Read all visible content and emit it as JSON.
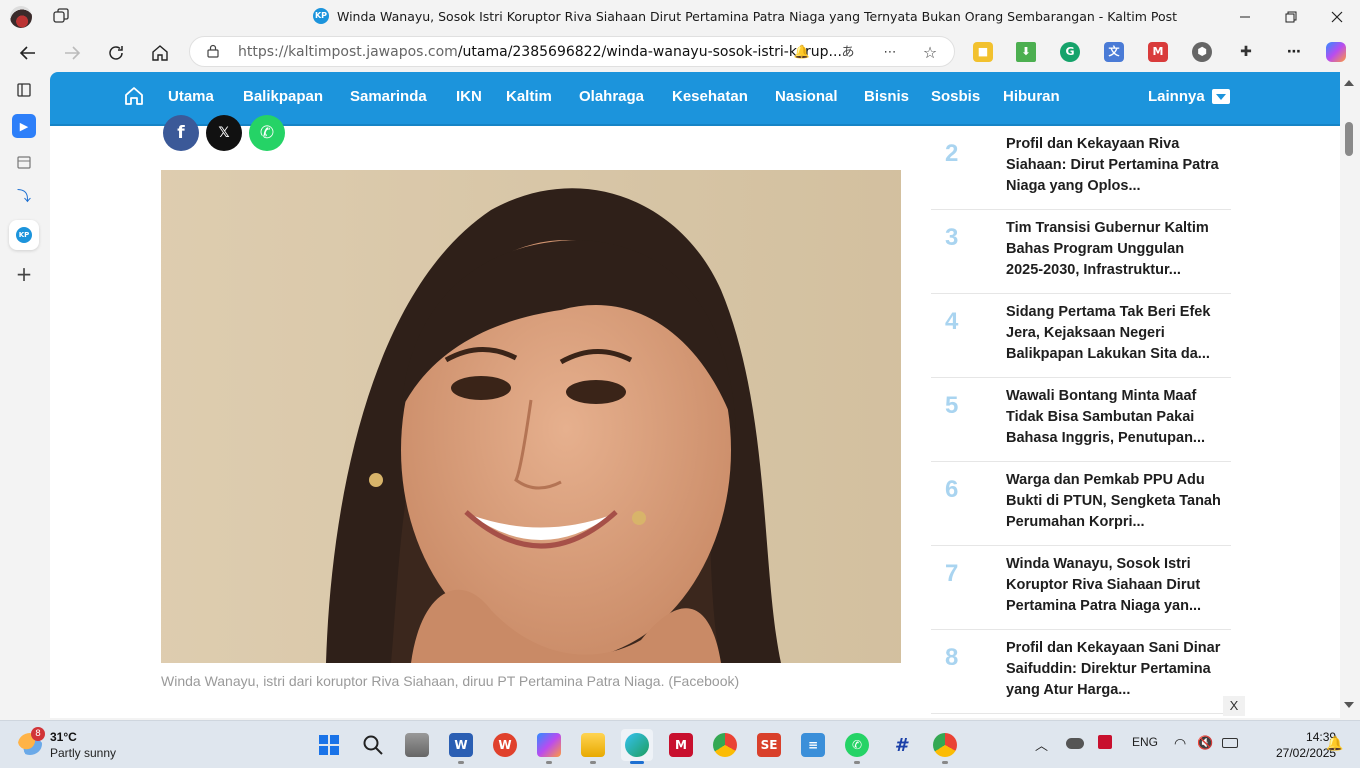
{
  "browser": {
    "tab_title": "Winda Wanayu, Sosok Istri Koruptor Riva Siahaan Dirut Pertamina Patra Niaga yang Ternyata Bukan Orang Sembarangan - Kaltim Post",
    "url_domain": "https://kaltimpost.jawapos.com",
    "url_path": "/utama/2385696822/winda-wanayu-sosok-istri-korup...",
    "site_badge": "KP"
  },
  "nav": {
    "items": [
      "Utama",
      "Balikpapan",
      "Samarinda",
      "IKN",
      "Kaltim",
      "Olahraga",
      "Kesehatan",
      "Nasional",
      "Bisnis",
      "Sosbis",
      "Hiburan"
    ],
    "more_label": "Lainnya"
  },
  "share": {
    "facebook": "f",
    "x": "𝕏",
    "whatsapp": "✆"
  },
  "article": {
    "caption": "Winda Wanayu, istri dari koruptor Riva Siahaan, diruu PT Pertamina Patra Niaga. (Facebook)"
  },
  "popular": [
    {
      "num": "2",
      "title": "Profil dan Kekayaan Riva Siahaan: Dirut Pertamina Patra Niaga yang Oplos..."
    },
    {
      "num": "3",
      "title": "Tim Transisi Gubernur Kaltim Bahas Program Unggulan 2025-2030, Infrastruktur..."
    },
    {
      "num": "4",
      "title": "Sidang Pertama Tak Beri Efek Jera, Kejaksaan Negeri Balikpapan Lakukan Sita da..."
    },
    {
      "num": "5",
      "title": "Wawali Bontang Minta Maaf Tidak Bisa Sambutan Pakai Bahasa Inggris, Penutupan..."
    },
    {
      "num": "6",
      "title": "Warga dan Pemkab PPU Adu Bukti di PTUN, Sengketa Tanah Perumahan Korpri..."
    },
    {
      "num": "7",
      "title": "Winda Wanayu, Sosok Istri Koruptor Riva Siahaan Dirut Pertamina Patra Niaga yan..."
    },
    {
      "num": "8",
      "title": "Profil dan Kekayaan Sani Dinar Saifuddin: Direktur Pertamina yang Atur Harga..."
    }
  ],
  "ad_close": "X",
  "taskbar": {
    "weather_badge": "8",
    "temperature": "31°C",
    "condition": "Partly sunny",
    "language": "ENG",
    "time": "14:39",
    "date": "27/02/2025"
  },
  "colors": {
    "brand": "#1c94dc",
    "popular_number": "#a9d4f0"
  }
}
